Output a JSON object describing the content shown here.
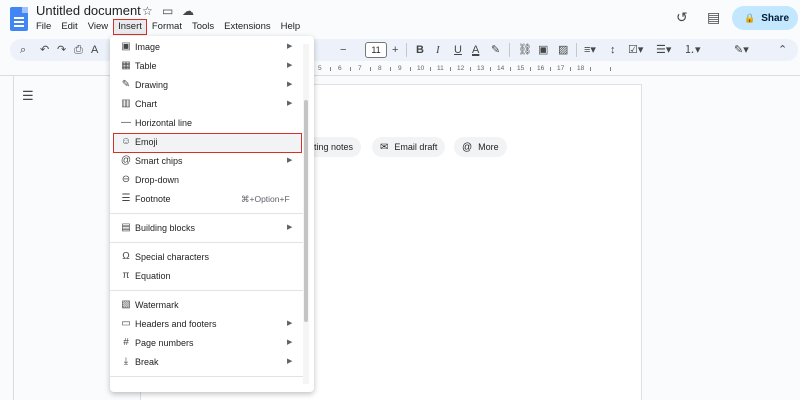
{
  "app": {
    "title": "Untitled document",
    "share_label": "Share"
  },
  "menubar": [
    "File",
    "Edit",
    "View",
    "Insert",
    "Format",
    "Tools",
    "Extensions",
    "Help"
  ],
  "toolbar": {
    "font_size": "11"
  },
  "ruler": {
    "numbers": [
      "5",
      "6",
      "7",
      "8",
      "9",
      "10",
      "11",
      "12",
      "13",
      "14",
      "15",
      "16",
      "17",
      "18"
    ]
  },
  "chips": {
    "meeting_notes": "eeting notes",
    "email_draft": "Email draft",
    "more": "More"
  },
  "insert_menu": {
    "items": [
      {
        "label": "Image",
        "icon": "image-icon",
        "glyph": "▣",
        "arrow": true
      },
      {
        "label": "Table",
        "icon": "table-icon",
        "glyph": "▦",
        "arrow": true
      },
      {
        "label": "Drawing",
        "icon": "drawing-icon",
        "glyph": "✎",
        "arrow": true
      },
      {
        "label": "Chart",
        "icon": "chart-icon",
        "glyph": "▥",
        "arrow": true
      },
      {
        "label": "Horizontal line",
        "icon": "horizontal-line-icon",
        "glyph": "—",
        "arrow": false
      },
      {
        "label": "Emoji",
        "icon": "emoji-icon",
        "glyph": "☺",
        "arrow": false
      },
      {
        "label": "Smart chips",
        "icon": "smart-chips-icon",
        "glyph": "@",
        "arrow": true
      },
      {
        "label": "Drop-down",
        "icon": "dropdown-icon",
        "glyph": "⊖",
        "arrow": false
      },
      {
        "label": "Footnote",
        "icon": "footnote-icon",
        "glyph": "☰",
        "shortcut": "⌘+Option+F"
      },
      {
        "label": "Building blocks",
        "icon": "building-blocks-icon",
        "glyph": "▤",
        "arrow": true
      },
      {
        "label": "Special characters",
        "icon": "special-characters-icon",
        "glyph": "Ω",
        "arrow": false
      },
      {
        "label": "Equation",
        "icon": "equation-icon",
        "glyph": "π",
        "arrow": false
      },
      {
        "label": "Watermark",
        "icon": "watermark-icon",
        "glyph": "▧",
        "arrow": false
      },
      {
        "label": "Headers and footers",
        "icon": "headers-footers-icon",
        "glyph": "▭",
        "arrow": true
      },
      {
        "label": "Page numbers",
        "icon": "page-numbers-icon",
        "glyph": "#",
        "arrow": true
      },
      {
        "label": "Break",
        "icon": "break-icon",
        "glyph": "⤓",
        "arrow": true
      }
    ]
  }
}
